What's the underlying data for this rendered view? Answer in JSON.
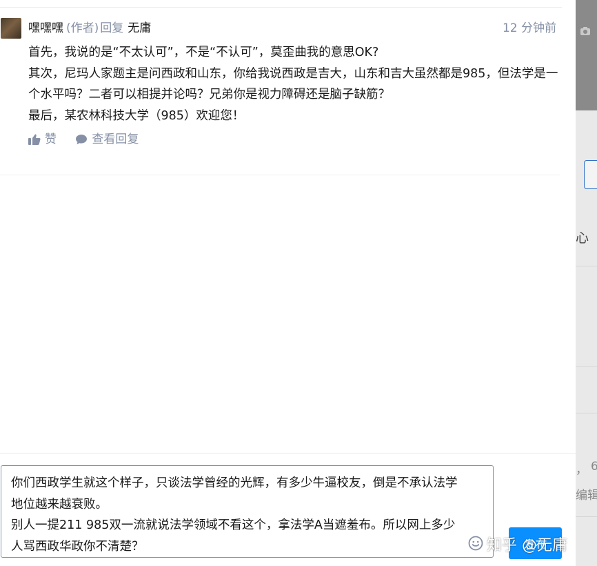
{
  "comment": {
    "author": "嘿嘿嘿",
    "author_tag": "(作者)",
    "reply_word": "回复",
    "reply_to": "无庸",
    "time": "12 分钟前",
    "lines": [
      "首先，我说的是“不太认可”，不是“不认可”，莫歪曲我的意思OK?",
      "其次，尼玛人家题主是问西政和山东，你给我说西政是吉大，山东和吉大虽然都是985，但法学是一个水平吗？二者可以相提并论吗？兄弟你是视力障碍还是脑子缺筋？",
      "最后，某农林科技大学（985）欢迎您！"
    ],
    "like_label": "赞",
    "view_replies_label": "查看回复"
  },
  "reply_box": {
    "lines": [
      "你们西政学生就这个样子，只谈法学曾经的光辉，有多少牛逼校友，倒是不承认法学地位越来越衰败。",
      "别人一提211 985双一流就说法学领域不看这个，拿法学A当遮羞布。所以网上多少人骂西政华政你不清楚？"
    ],
    "send_label": "发布"
  },
  "watermark": "知乎 @无庸",
  "background_fragments": {
    "xin": "心",
    "comma": "，",
    "six": "6",
    "bian": "编辑"
  },
  "icons": {
    "avatar": "avatar",
    "like": "thumbs-up-icon",
    "reply": "chat-bubble-icon",
    "emoji": "emoji-smile-icon",
    "camera": "camera-icon"
  },
  "colors": {
    "primary_text": "#1a1a1a",
    "secondary_text": "#8590a6",
    "accent": "#0a8fff"
  }
}
